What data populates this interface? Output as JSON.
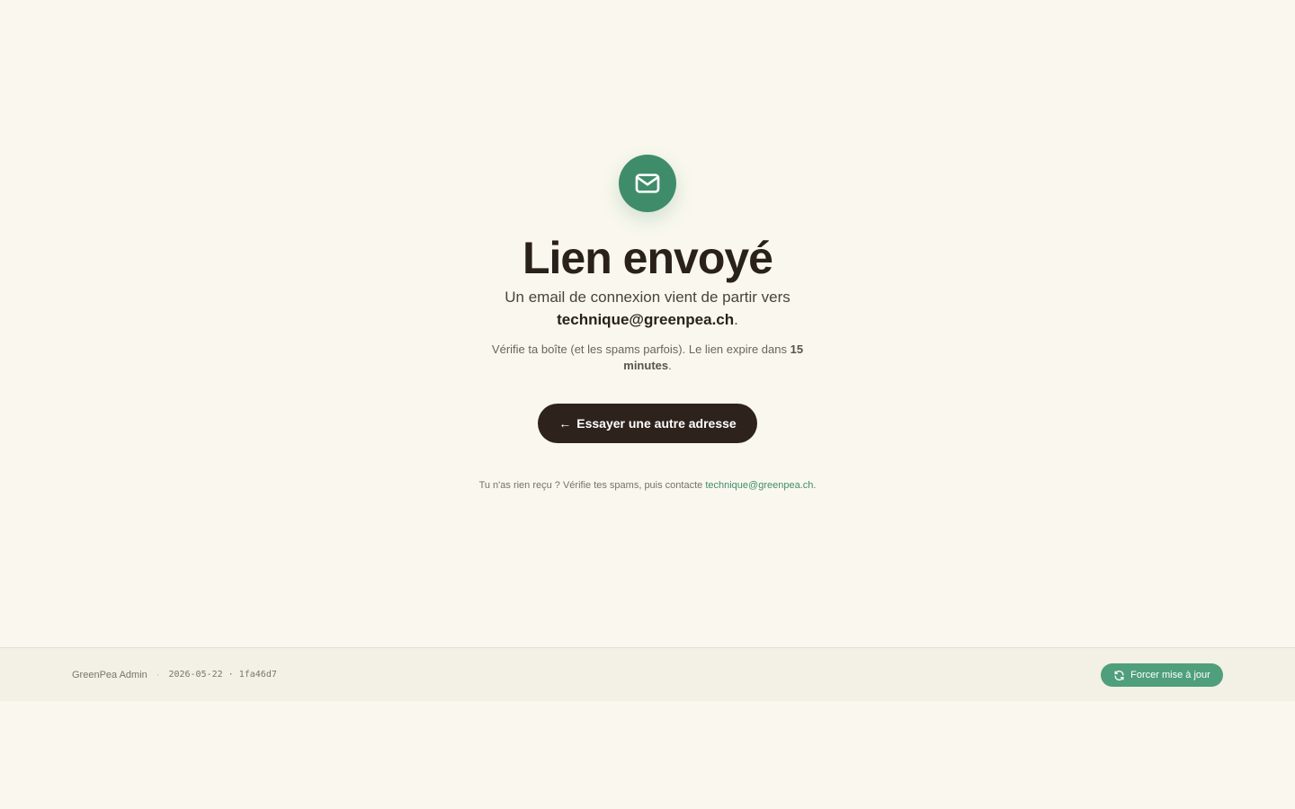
{
  "colors": {
    "background": "#faf8ee",
    "accent": "#3f8c6b",
    "primary_button": "#2e231c",
    "footer_background": "#f3f0e6",
    "refresh_button": "#4f9f7c"
  },
  "hero": {
    "icon": "mail-icon",
    "title": "Lien envoyé",
    "lead_text": "Un email de connexion vient de partir vers",
    "email": "technique@greenpea.ch",
    "period": ".",
    "hint_text": "Vérifie ta boîte (et les spams parfois). Le lien expire dans",
    "hint_duration": "15 minutes",
    "hint_period": "."
  },
  "actions": {
    "back_arrow": "←",
    "back_label": "Essayer une autre adresse"
  },
  "help": {
    "text": "Tu n'as rien reçu ? Vérifie tes spams, puis contacte",
    "contact_email": "technique@greenpea.ch",
    "period": "."
  },
  "footer": {
    "app_name": "GreenPea Admin",
    "separator": "·",
    "build_info": "2026-05-22 · 1fa46d7",
    "refresh_icon": "refresh-icon",
    "refresh_label": "Forcer mise à jour"
  }
}
